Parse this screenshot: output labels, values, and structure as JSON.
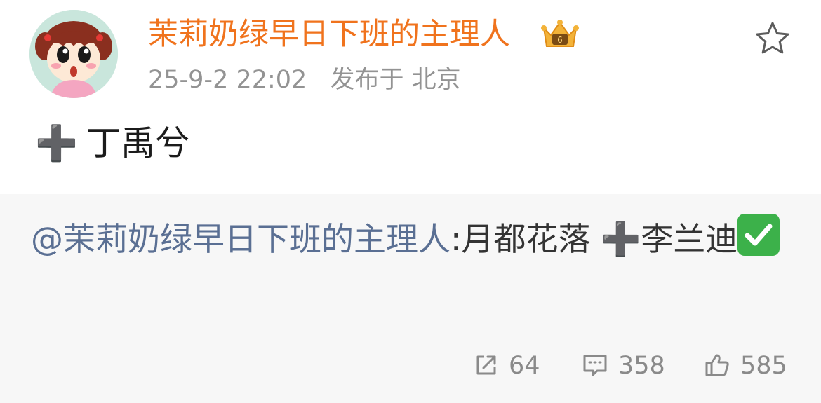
{
  "post": {
    "username": "茉莉奶绿早日下班的主理人",
    "time": "25-9-2 22:02",
    "location": "发布于 北京",
    "content_plus": "➕",
    "content_text": "丁禹兮"
  },
  "repost": {
    "mention": "@茉莉奶绿早日下班的主理人",
    "text_before_plus": ":月都花落 ",
    "plus": "➕",
    "text_after_plus": "李兰迪"
  },
  "actions": {
    "repost_count": "64",
    "comment_count": "358",
    "like_count": "585"
  },
  "icons": {
    "avatar": "cartoon-girl-avatar",
    "vip": "crown-vip-icon",
    "favorite": "star-outline-icon",
    "check": "green-check-emoji",
    "repost": "share-arrow-icon",
    "comment": "comment-bubble-icon",
    "like": "thumbs-up-icon"
  },
  "colors": {
    "username": "#f0731d",
    "meta": "#939393",
    "mention": "#5a6f93",
    "repost_bg": "#f7f7f7",
    "action": "#8a8a8a"
  }
}
